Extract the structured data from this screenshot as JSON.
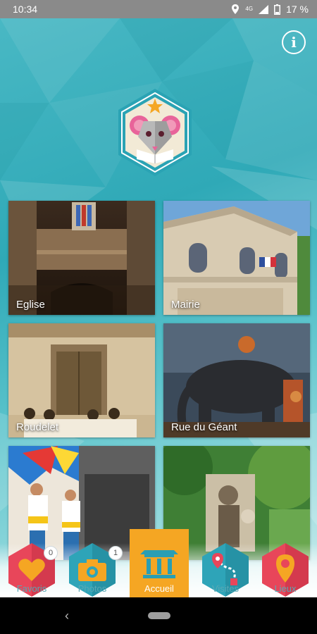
{
  "status": {
    "time": "10:34",
    "network": "4G",
    "battery": "17 %"
  },
  "header": {
    "info_icon": "info-icon",
    "info_glyph": "i"
  },
  "places": [
    {
      "label": "Eglise"
    },
    {
      "label": "Mairie"
    },
    {
      "label": "Roudelet"
    },
    {
      "label": "Rue du Géant"
    },
    {
      "label": ""
    },
    {
      "label": ""
    }
  ],
  "tabs": {
    "favoris": {
      "label": "Favoris",
      "badge": "0",
      "color": "#e8465a"
    },
    "photos": {
      "label": "Photos",
      "badge": "1",
      "color": "#2ea4b8"
    },
    "accueil": {
      "label": "Accueil",
      "color": "#f5a623"
    },
    "visites": {
      "label": "Visites",
      "color": "#2ea4b8"
    },
    "lieux": {
      "label": "Lieux",
      "color": "#e8465a"
    }
  },
  "colors": {
    "accent": "#f5a623",
    "teal": "#2fa9b7",
    "red": "#e8465a"
  }
}
